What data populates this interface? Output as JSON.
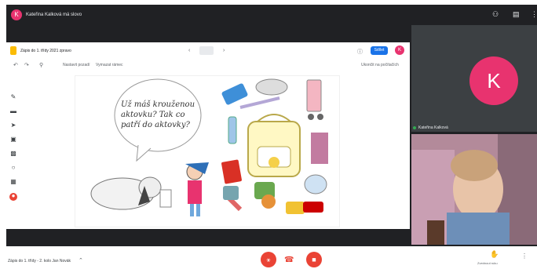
{
  "presenter": {
    "initial": "K",
    "label": "Kateřina Kalková má slovo"
  },
  "jamboard": {
    "title": "Zápis do 1. třídy 2021 zpravo",
    "share_label": "Sdílet",
    "user_initial": "K",
    "toolbar_left": "Nastavit pozadí",
    "toolbar_mid": "Vymazat rámec",
    "toolbar_right": "Ukončit na počítačích",
    "speech_bubble": "Už máš krouženou aktovku? Tak co patří do aktovky?"
  },
  "participants": [
    {
      "initial": "K",
      "name": "Kateřina Kalková"
    },
    {
      "name": ""
    }
  ],
  "bottom": {
    "meeting_title": "Zápis do 1. třídy - 2. kolo  Jan Novák",
    "hand_label": "Zvednout ruku"
  },
  "colors": {
    "accent": "#e8336f",
    "dark": "#202124",
    "end_call": "#ea4335",
    "share": "#1a73e8"
  }
}
